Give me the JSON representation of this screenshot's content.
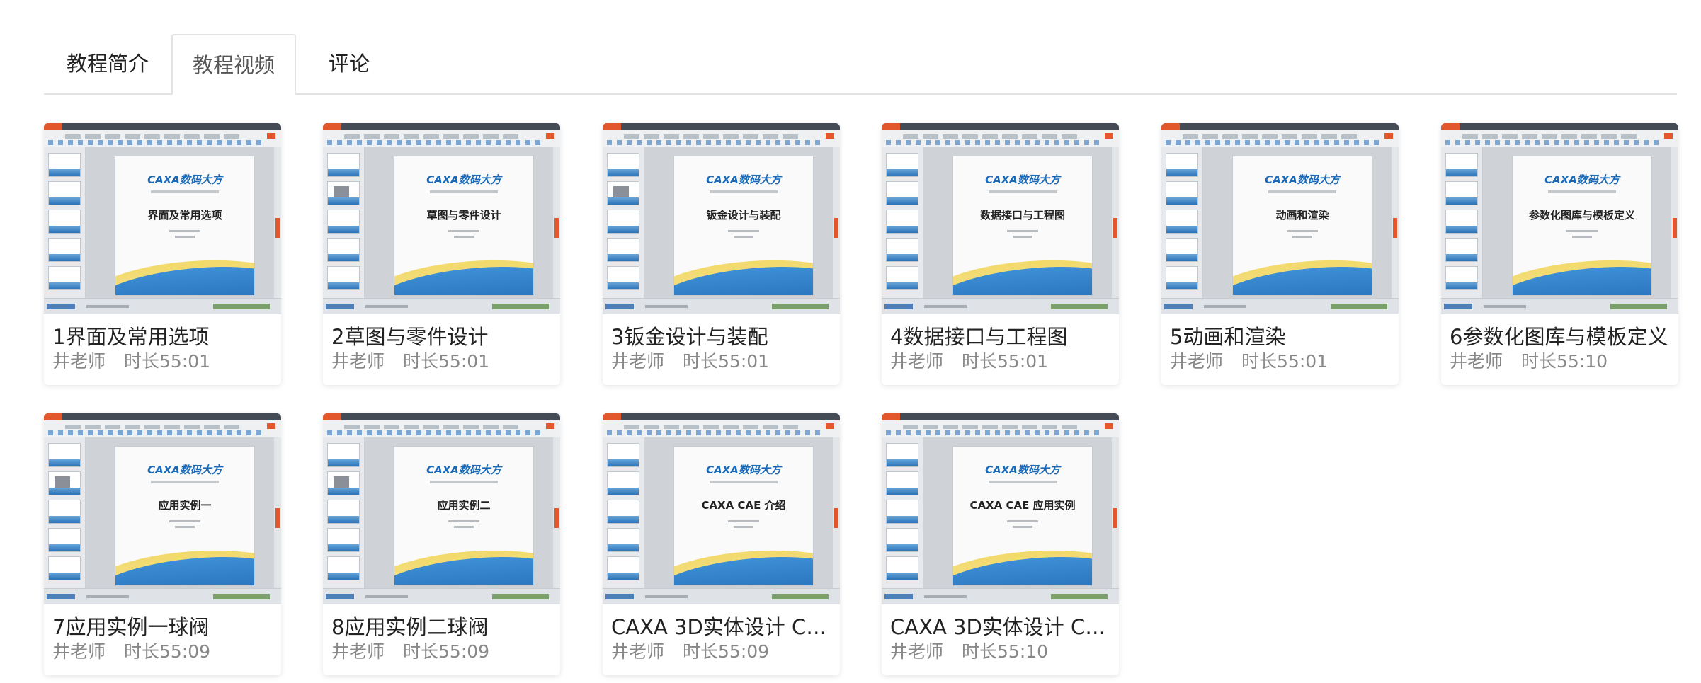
{
  "tabs": [
    {
      "label": "教程简介"
    },
    {
      "label": "教程视频"
    },
    {
      "label": "评论"
    }
  ],
  "active_tab": "教程视频",
  "thumbnail_brand": "CAXA数码大方",
  "videos": [
    {
      "title": "1界面及常用选项",
      "teacher": "井老师",
      "duration": "时长55:01",
      "slide_title": "界面及常用选项"
    },
    {
      "title": "2草图与零件设计",
      "teacher": "井老师",
      "duration": "时长55:01",
      "slide_title": "草图与零件设计"
    },
    {
      "title": "3钣金设计与装配",
      "teacher": "井老师",
      "duration": "时长55:01",
      "slide_title": "钣金设计与装配"
    },
    {
      "title": "4数据接口与工程图",
      "teacher": "井老师",
      "duration": "时长55:01",
      "slide_title": "数据接口与工程图"
    },
    {
      "title": "5动画和渲染",
      "teacher": "井老师",
      "duration": "时长55:01",
      "slide_title": "动画和渲染"
    },
    {
      "title": "6参数化图库与模板定义",
      "teacher": "井老师",
      "duration": "时长55:10",
      "slide_title": "参数化图库与模板定义"
    },
    {
      "title": "7应用实例一球阀",
      "teacher": "井老师",
      "duration": "时长55:09",
      "slide_title": "应用实例一"
    },
    {
      "title": "8应用实例二球阀",
      "teacher": "井老师",
      "duration": "时长55:09",
      "slide_title": "应用实例二"
    },
    {
      "title": "CAXA 3D实体设计 CA...",
      "teacher": "井老师",
      "duration": "时长55:09",
      "slide_title": "CAXA CAE 介绍"
    },
    {
      "title": "CAXA 3D实体设计 CA...",
      "teacher": "井老师",
      "duration": "时长55:10",
      "slide_title": "CAXA CAE 应用实例"
    }
  ]
}
